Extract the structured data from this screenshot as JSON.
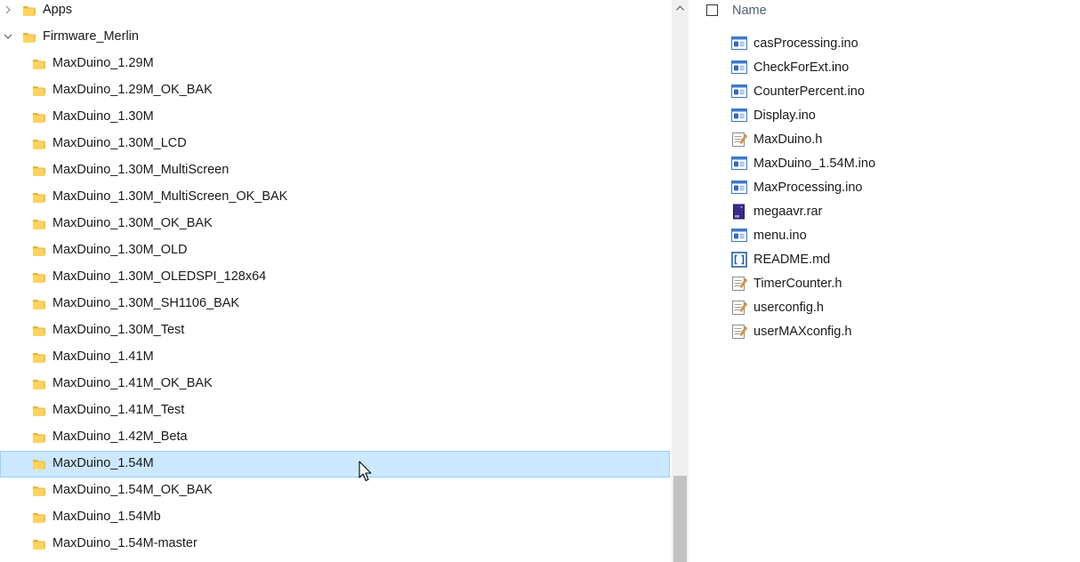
{
  "nav_tree": {
    "items": [
      {
        "label": "Apps",
        "level": 0,
        "expanded": false,
        "has_children": true,
        "selected": false
      },
      {
        "label": "Firmware_Merlin",
        "level": 0,
        "expanded": true,
        "has_children": true,
        "selected": false
      },
      {
        "label": "MaxDuino_1.29M",
        "level": 1,
        "selected": false
      },
      {
        "label": "MaxDuino_1.29M_OK_BAK",
        "level": 1,
        "selected": false
      },
      {
        "label": "MaxDuino_1.30M",
        "level": 1,
        "selected": false
      },
      {
        "label": "MaxDuino_1.30M_LCD",
        "level": 1,
        "selected": false
      },
      {
        "label": "MaxDuino_1.30M_MultiScreen",
        "level": 1,
        "selected": false
      },
      {
        "label": "MaxDuino_1.30M_MultiScreen_OK_BAK",
        "level": 1,
        "selected": false
      },
      {
        "label": "MaxDuino_1.30M_OK_BAK",
        "level": 1,
        "selected": false
      },
      {
        "label": "MaxDuino_1.30M_OLD",
        "level": 1,
        "selected": false
      },
      {
        "label": "MaxDuino_1.30M_OLEDSPI_128x64",
        "level": 1,
        "selected": false
      },
      {
        "label": "MaxDuino_1.30M_SH1106_BAK",
        "level": 1,
        "selected": false
      },
      {
        "label": "MaxDuino_1.30M_Test",
        "level": 1,
        "selected": false
      },
      {
        "label": "MaxDuino_1.41M",
        "level": 1,
        "selected": false
      },
      {
        "label": "MaxDuino_1.41M_OK_BAK",
        "level": 1,
        "selected": false
      },
      {
        "label": "MaxDuino_1.41M_Test",
        "level": 1,
        "selected": false
      },
      {
        "label": "MaxDuino_1.42M_Beta",
        "level": 1,
        "selected": false
      },
      {
        "label": "MaxDuino_1.54M",
        "level": 1,
        "selected": true
      },
      {
        "label": "MaxDuino_1.54M_OK_BAK",
        "level": 1,
        "selected": false
      },
      {
        "label": "MaxDuino_1.54Mb",
        "level": 1,
        "selected": false
      },
      {
        "label": "MaxDuino_1.54M-master",
        "level": 1,
        "selected": false
      }
    ]
  },
  "file_list": {
    "column_header": "Name",
    "files": [
      {
        "name": "casProcessing.ino",
        "icon": "arduino-file-icon"
      },
      {
        "name": "CheckForExt.ino",
        "icon": "arduino-file-icon"
      },
      {
        "name": "CounterPercent.ino",
        "icon": "arduino-file-icon"
      },
      {
        "name": "Display.ino",
        "icon": "arduino-file-icon"
      },
      {
        "name": "MaxDuino.h",
        "icon": "text-file-icon"
      },
      {
        "name": "MaxDuino_1.54M.ino",
        "icon": "arduino-file-icon"
      },
      {
        "name": "MaxProcessing.ino",
        "icon": "arduino-file-icon"
      },
      {
        "name": "megaavr.rar",
        "icon": "archive-file-icon"
      },
      {
        "name": "menu.ino",
        "icon": "arduino-file-icon"
      },
      {
        "name": "README.md",
        "icon": "markdown-file-icon"
      },
      {
        "name": "TimerCounter.h",
        "icon": "text-file-icon"
      },
      {
        "name": "userconfig.h",
        "icon": "text-file-icon"
      },
      {
        "name": "userMAXconfig.h",
        "icon": "text-file-icon"
      }
    ]
  },
  "colors": {
    "selection_bg": "#cce8ff",
    "selection_border": "#99d1ff",
    "folder_yellow": "#ffd35e",
    "header_text": "#4c607a",
    "scrollbar_track": "#f0f0f0",
    "scrollbar_thumb": "#c2c2c2"
  }
}
